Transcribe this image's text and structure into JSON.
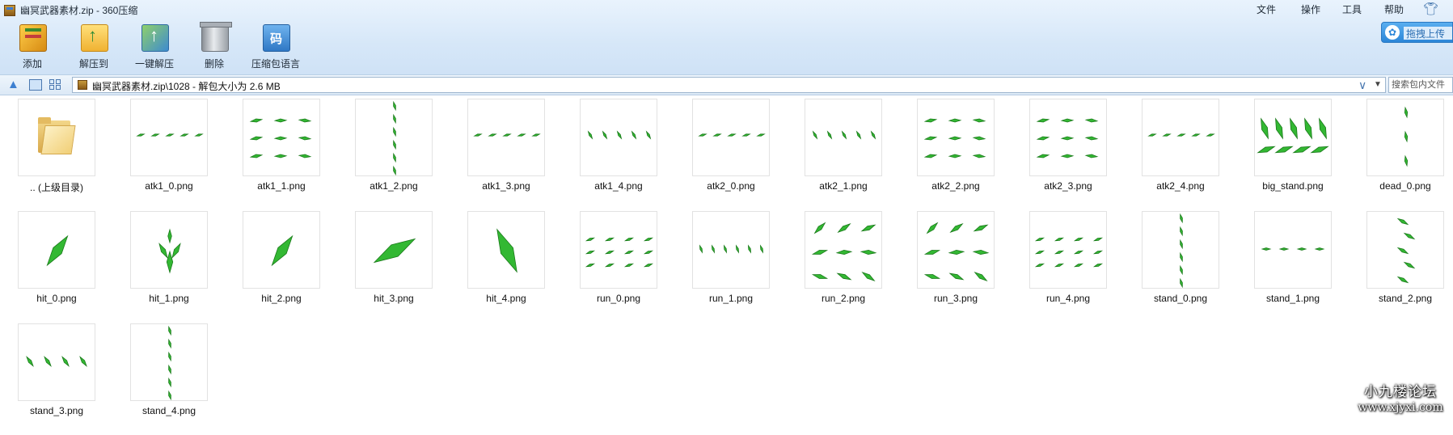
{
  "window": {
    "title": "幽冥武器素材.zip - 360压缩",
    "menu": [
      "文件",
      "操作",
      "工具",
      "帮助"
    ],
    "skin_icon": "shirt-icon"
  },
  "toolbar": {
    "add_label": "添加",
    "extract_label": "解压到",
    "onekey_label": "一键解压",
    "delete_label": "删除",
    "lang_label": "压缩包语言",
    "upload_label": "拖拽上传",
    "cloud_glyph": "✿"
  },
  "address": {
    "path": "幽冥武器素材.zip\\1028 - 解包大小为 2.6 MB",
    "search_placeholder": "搜索包内文件"
  },
  "files": [
    {
      "name": ".. (上级目录)",
      "kind": "folder"
    },
    {
      "name": "atk1_0.png",
      "kind": "row5"
    },
    {
      "name": "atk1_1.png",
      "kind": "grid3"
    },
    {
      "name": "atk1_2.png",
      "kind": "vertical"
    },
    {
      "name": "atk1_3.png",
      "kind": "row5"
    },
    {
      "name": "atk1_4.png",
      "kind": "row5b"
    },
    {
      "name": "atk2_0.png",
      "kind": "row5"
    },
    {
      "name": "atk2_1.png",
      "kind": "row5b"
    },
    {
      "name": "atk2_2.png",
      "kind": "grid3"
    },
    {
      "name": "atk2_3.png",
      "kind": "grid3"
    },
    {
      "name": "atk2_4.png",
      "kind": "row5"
    },
    {
      "name": "big_stand.png",
      "kind": "big"
    },
    {
      "name": "dead_0.png",
      "kind": "vertical3"
    },
    {
      "name": "hit_0.png",
      "kind": "diag"
    },
    {
      "name": "hit_1.png",
      "kind": "tree"
    },
    {
      "name": "hit_2.png",
      "kind": "diag"
    },
    {
      "name": "hit_3.png",
      "kind": "diag_long"
    },
    {
      "name": "hit_4.png",
      "kind": "diag_rev"
    },
    {
      "name": "run_0.png",
      "kind": "grid4"
    },
    {
      "name": "run_1.png",
      "kind": "row6"
    },
    {
      "name": "run_2.png",
      "kind": "grid6"
    },
    {
      "name": "run_3.png",
      "kind": "grid6"
    },
    {
      "name": "run_4.png",
      "kind": "grid4"
    },
    {
      "name": "stand_0.png",
      "kind": "vertical"
    },
    {
      "name": "stand_1.png",
      "kind": "row4"
    },
    {
      "name": "stand_2.png",
      "kind": "vertical_slant"
    },
    {
      "name": "stand_3.png",
      "kind": "row4b"
    },
    {
      "name": "stand_4.png",
      "kind": "vertical"
    }
  ],
  "watermark": {
    "title": "小九楼论坛",
    "url": "www.xjyxi.com"
  },
  "colors": {
    "sprite": "#33b833",
    "sprite_dark": "#1a7a1a",
    "titlebar": "#d6e7f8",
    "accent": "#2c86d8"
  }
}
